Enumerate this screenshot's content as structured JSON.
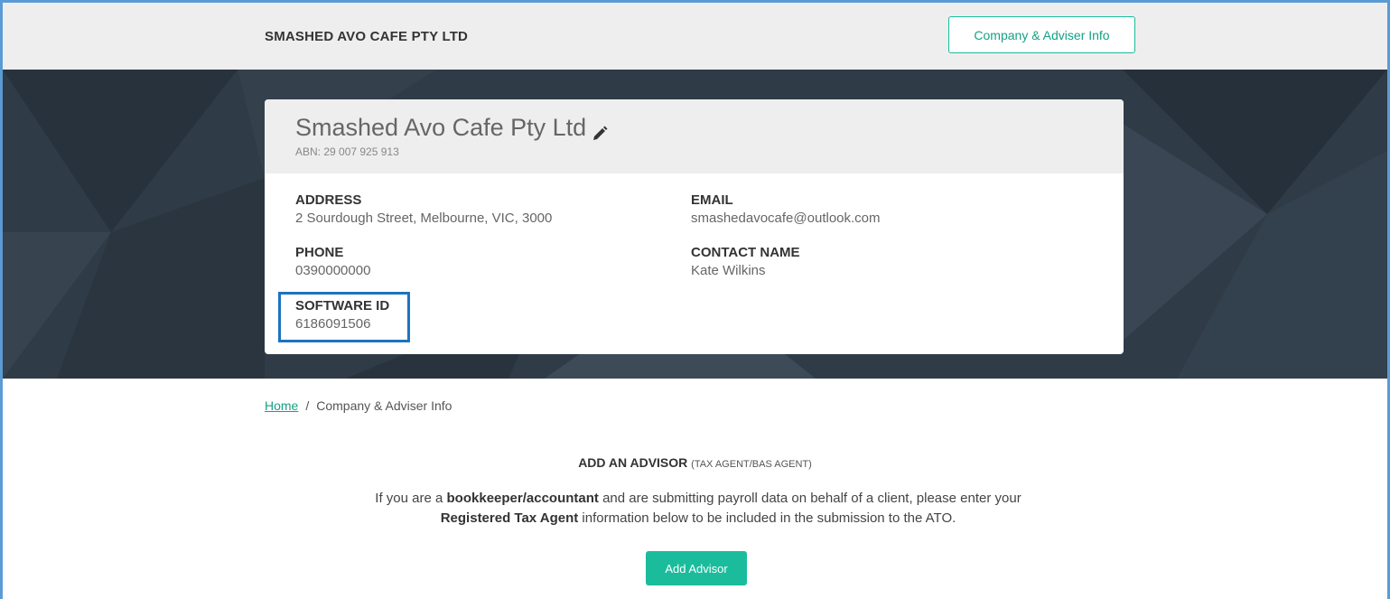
{
  "header": {
    "company_name": "SMASHED AVO CAFE PTY LTD",
    "info_button": "Company & Adviser Info"
  },
  "card": {
    "title": "Smashed Avo Cafe Pty Ltd",
    "abn": "ABN: 29 007 925 913",
    "fields": {
      "address_label": "ADDRESS",
      "address_value": "2 Sourdough Street, Melbourne, VIC, 3000",
      "email_label": "EMAIL",
      "email_value": "smashedavocafe@outlook.com",
      "phone_label": "PHONE",
      "phone_value": "0390000000",
      "contact_label": "CONTACT NAME",
      "contact_value": "Kate Wilkins",
      "software_label": "SOFTWARE ID",
      "software_value": "6186091506"
    }
  },
  "breadcrumb": {
    "home": "Home",
    "separator": "/",
    "current": "Company & Adviser Info"
  },
  "advisor": {
    "heading": "ADD AN ADVISOR",
    "heading_sub": "(TAX AGENT/BAS AGENT)",
    "text_1": "If you are a ",
    "text_bold_1": "bookkeeper/accountant",
    "text_2": " and are submitting payroll data on behalf of a client, please enter your ",
    "text_bold_2": "Registered Tax Agent",
    "text_3": " information below to be included in the submission to the ATO.",
    "button": "Add Advisor"
  },
  "colors": {
    "accent": "#1abc9c",
    "highlight": "#1e73be",
    "hero_bg": "#2f3b47"
  },
  "icons": [
    "pencil-icon"
  ]
}
